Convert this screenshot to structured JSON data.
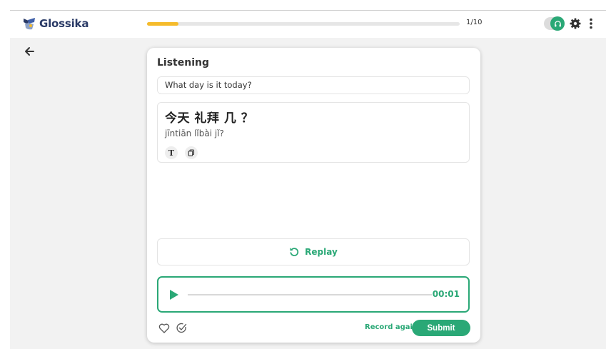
{
  "header": {
    "brand_name": "Glossika",
    "progress_fraction": 0.1,
    "progress_label": "1/10",
    "audio_toggle_on": true,
    "icons": [
      "glossika-logo-icon",
      "headphones-icon",
      "gear-icon",
      "kebab-menu-icon",
      "back-arrow-icon"
    ]
  },
  "card": {
    "title": "Listening",
    "prompt_text": "What day is it today?",
    "answer": {
      "hanzi": "今天 礼拜 几 ？",
      "pinyin": "jīntiān lǐbài jǐ?",
      "tool_text_label": "T"
    },
    "replay_label": "Replay",
    "player": {
      "time": "00:01",
      "position_fraction": 0
    },
    "record_again_label": "Record again",
    "submit_label": "Submit"
  },
  "colors": {
    "accent_green": "#2aa876",
    "progress_yellow": "#f5bb2b",
    "brand_navy": "#2a3a66"
  }
}
